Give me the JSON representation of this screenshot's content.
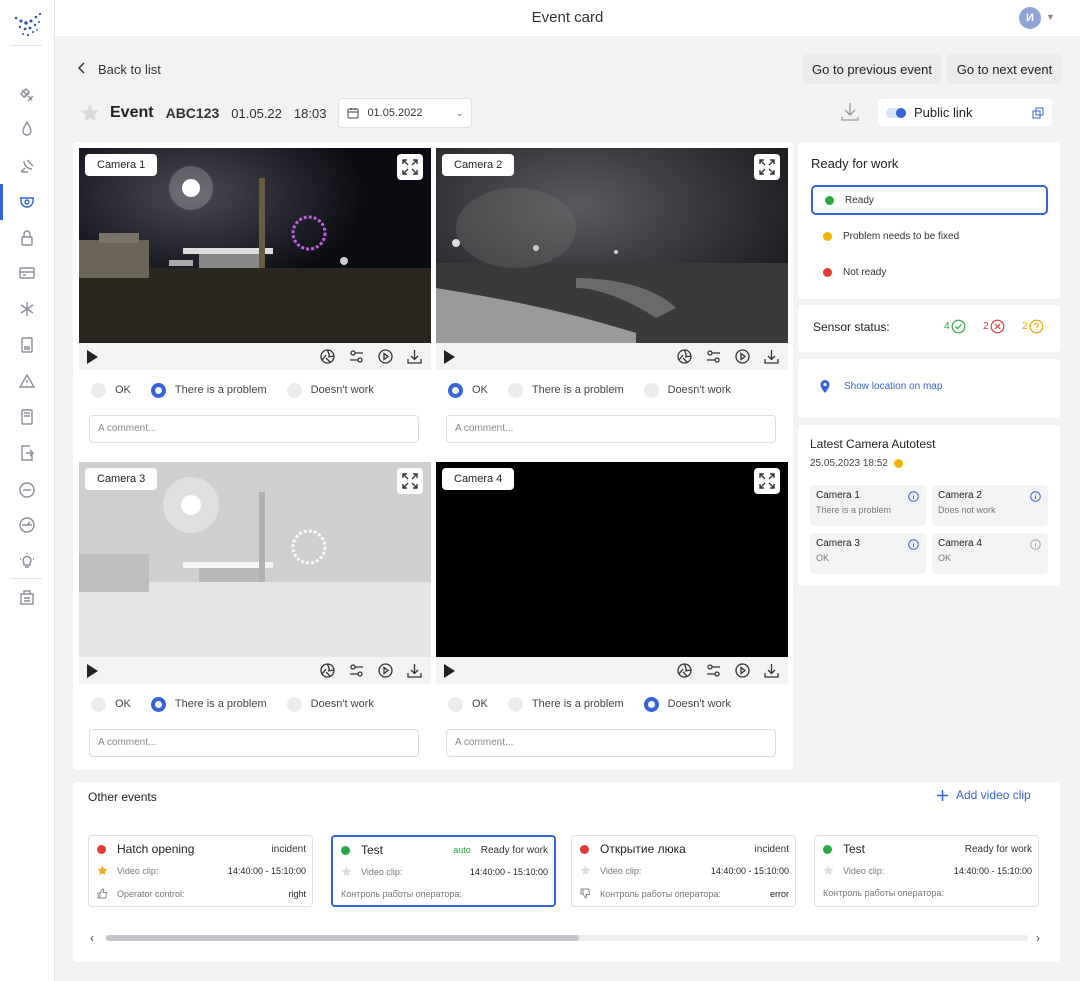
{
  "topbar": {
    "title": "Event card",
    "avatar_letter": "И"
  },
  "nav": {
    "back_label": "Back to list",
    "prev_label": "Go to previous event",
    "next_label": "Go to next event"
  },
  "event": {
    "label": "Event",
    "code": "ABC123",
    "date": "01.05.22",
    "time": "18:03",
    "date_select": "01.05.2022",
    "public_link_label": "Public link"
  },
  "cameras": [
    {
      "label": "Camera 1",
      "status": "There is a problem",
      "comment_placeholder": "A comment..."
    },
    {
      "label": "Camera 2",
      "status": "OK",
      "comment_placeholder": "A comment..."
    },
    {
      "label": "Camera 3",
      "status": "There is a problem",
      "comment_placeholder": "A comment..."
    },
    {
      "label": "Camera 4",
      "status": "Doesn't work",
      "comment_placeholder": "A comment..."
    }
  ],
  "status_options": [
    "OK",
    "There is a problem",
    "Doesn't work"
  ],
  "ready_for_work": {
    "title": "Ready for work",
    "options": [
      {
        "label": "Ready",
        "color": "#28a745",
        "selected": true
      },
      {
        "label": "Problem needs to be fixed",
        "color": "#f5b400",
        "selected": false
      },
      {
        "label": "Not ready",
        "color": "#e53935",
        "selected": false
      }
    ]
  },
  "sensor_status": {
    "title": "Sensor status:",
    "ok_count": "4",
    "error_count": "2",
    "unknown_count": "2"
  },
  "location": {
    "label": "Show location on map"
  },
  "autotest": {
    "title": "Latest Camera Autotest",
    "date": "25.05.2023 18:52",
    "status_color": "#f5b400",
    "cells": [
      {
        "name": "Camera 1",
        "status": "There is a problem"
      },
      {
        "name": "Camera 2",
        "status": "Does not work"
      },
      {
        "name": "Camera 3",
        "status": "OK"
      },
      {
        "name": "Camera 4",
        "status": "OK"
      }
    ]
  },
  "other_events": {
    "title": "Other events",
    "add_label": "Add video clip",
    "items": [
      {
        "title": "Hatch opening",
        "type": "incident",
        "auto": "",
        "dot_color": "#e53935",
        "clip_label": "Video clip:",
        "clip_time": "14:40:00 - 15:10:00",
        "row2_label": "Operator control:",
        "row2_value": "right"
      },
      {
        "title": "Test",
        "type": "Ready for work",
        "auto": "auto",
        "dot_color": "#28a745",
        "clip_label": "Video clip:",
        "clip_time": "14:40:00 - 15:10:00",
        "row2_label": "Контроль работы оператора:",
        "row2_value": ""
      },
      {
        "title": "Открытие люка",
        "type": "incident",
        "auto": "",
        "dot_color": "#e53935",
        "clip_label": "Video clip:",
        "clip_time": "14:40:00 - 15:10:00",
        "row2_label": "Контроль работы оператора:",
        "row2_value": "error"
      },
      {
        "title": "Test",
        "type": "Ready for work",
        "auto": "",
        "dot_color": "#28a745",
        "clip_label": "Video clip:",
        "clip_time": "14:40:00 - 15:10:00",
        "row2_label": "Контроль работы оператора:",
        "row2_value": ""
      }
    ]
  }
}
